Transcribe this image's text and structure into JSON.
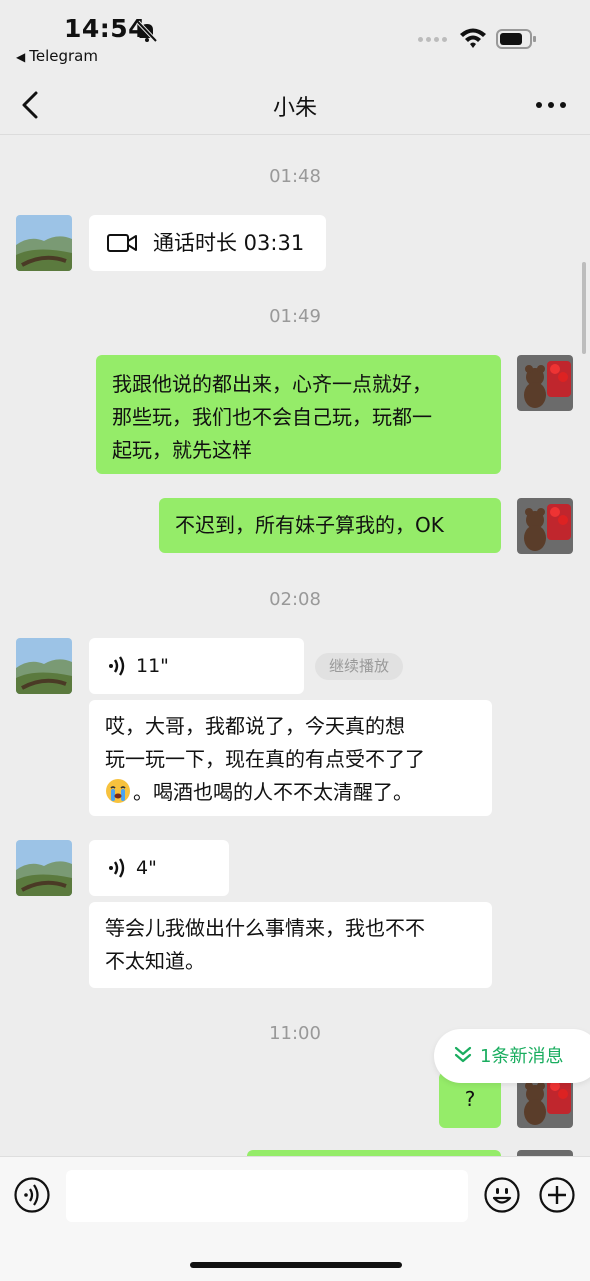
{
  "status": {
    "time": "14:54",
    "back_app": "Telegram"
  },
  "nav": {
    "title": "小朱"
  },
  "messages": {
    "ts1": "01:48",
    "call_text": "通话时长 03:31",
    "ts2": "01:49",
    "m1": "我跟他说的都出来，心齐一点就好，\n那些玩，我们也不会自己玩，玩都一\n起玩，就先这样",
    "m2": "不迟到，所有妹子算我的，OK",
    "ts3": "02:08",
    "voice1_dur": "11\"",
    "continue_label": "继续播放",
    "m3_part1": "哎，大哥，我都说了，今天真的想\n玩一玩一下，现在真的有点受不了了",
    "m3_part2": "。喝酒也喝的人不不太清醒了。",
    "voice2_dur": "4\"",
    "m4": "等会儿我做出什么事情来，我也不不\n不太知道。",
    "ts4": "11:00",
    "m5": "?"
  },
  "new_msg_label": "1条新消息",
  "input": {
    "value": ""
  },
  "icons": {
    "call": "video-call-icon",
    "voice": "voice-wave-icon",
    "emoji": "emoji-icon",
    "plus": "plus-icon",
    "cry": "loudly-crying-emoji"
  },
  "colors": {
    "sent_bubble": "#95ec69",
    "received_bubble": "#ffffff",
    "accent": "#1aad5f"
  }
}
